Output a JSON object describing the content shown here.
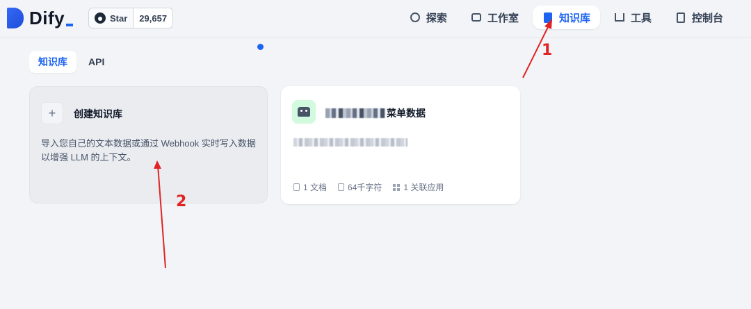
{
  "brand": {
    "name": "Dify"
  },
  "github": {
    "star_label": "Star",
    "star_count": "29,657"
  },
  "nav": [
    {
      "label": "探索",
      "icon": "compass-icon",
      "active": false
    },
    {
      "label": "工作室",
      "icon": "robot-icon",
      "active": false
    },
    {
      "label": "知识库",
      "icon": "book-icon",
      "active": true
    },
    {
      "label": "工具",
      "icon": "tool-icon",
      "active": false
    },
    {
      "label": "控制台",
      "icon": "document-icon",
      "active": false
    }
  ],
  "tabs": [
    {
      "label": "知识库",
      "active": true
    },
    {
      "label": "API",
      "active": false
    }
  ],
  "create_card": {
    "title": "创建知识库",
    "description": "导入您自己的文本数据或通过 Webhook 实时写入数据以增强 LLM 的上下文。"
  },
  "knowledge_card": {
    "title_suffix": "菜单数据",
    "meta": {
      "docs": "1 文档",
      "chars": "64千字符",
      "apps": "1 关联应用"
    }
  },
  "annotations": {
    "one": "1",
    "two": "2"
  },
  "colors": {
    "accent": "#1c64f2",
    "annotation": "#e02424"
  }
}
